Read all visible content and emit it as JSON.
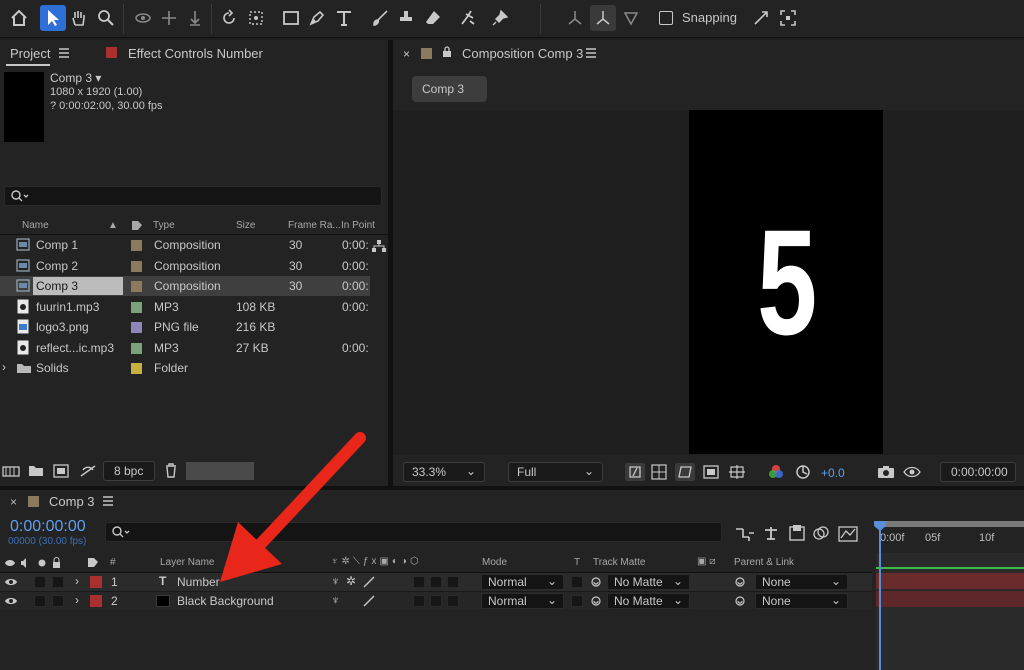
{
  "toolbar": {
    "snapping_label": "Snapping"
  },
  "project": {
    "tab_label": "Project",
    "effect_tab_label": "Effect Controls Number",
    "selected_item": {
      "name": "Comp 3",
      "dimensions": "1080 x 1920 (1.00)",
      "duration": "? 0:00:02:00, 30.00 fps"
    },
    "columns": {
      "name": "Name",
      "type": "Type",
      "size": "Size",
      "frame_rate": "Frame Ra...",
      "in_point": "In Point"
    },
    "rows": [
      {
        "name": "Comp 1",
        "type": "Composition",
        "size": "",
        "fps": "30",
        "in": "0:00:",
        "color": "#8c7a5e"
      },
      {
        "name": "Comp 2",
        "type": "Composition",
        "size": "",
        "fps": "30",
        "in": "0:00:",
        "color": "#8c7a5e"
      },
      {
        "name": "Comp 3",
        "type": "Composition",
        "size": "",
        "fps": "30",
        "in": "0:00:",
        "color": "#8c7a5e"
      },
      {
        "name": "fuurin1.mp3",
        "type": "MP3",
        "size": "108 KB",
        "fps": "",
        "in": "0:00:",
        "color": "#7aa178"
      },
      {
        "name": "logo3.png",
        "type": "PNG file",
        "size": "216 KB",
        "fps": "",
        "in": "",
        "color": "#8e86b8"
      },
      {
        "name": "reflect...ic.mp3",
        "type": "MP3",
        "size": "27 KB",
        "fps": "",
        "in": "0:00:",
        "color": "#7aa178"
      },
      {
        "name": "Solids",
        "type": "Folder",
        "size": "",
        "fps": "",
        "in": "",
        "color": "#c8b040"
      }
    ],
    "bpc_label": "8 bpc"
  },
  "viewer": {
    "tab_label": "Composition Comp 3",
    "comp_chip": "Comp 3",
    "canvas_text": "5",
    "zoom": "33.3%",
    "resolution": "Full",
    "exposure": "+0.0",
    "timecode": "0:00:00:00"
  },
  "timeline": {
    "tab_label": "Comp 3",
    "timecode": "0:00:00:00",
    "frames": "00000 (30.00 fps)",
    "columns": {
      "num": "#",
      "layer_name": "Layer Name",
      "mode": "Mode",
      "t": "T",
      "track_matte": "Track Matte",
      "parent": "Parent & Link"
    },
    "ruler": {
      "start": "0:00f",
      "mid": "05f",
      "end": "10f"
    },
    "layers": [
      {
        "num": "1",
        "name": "Number",
        "mode": "Normal",
        "matte": "No Matte",
        "parent": "None"
      },
      {
        "num": "2",
        "name": "Black Background",
        "mode": "Normal",
        "matte": "No Matte",
        "parent": "None"
      }
    ]
  }
}
